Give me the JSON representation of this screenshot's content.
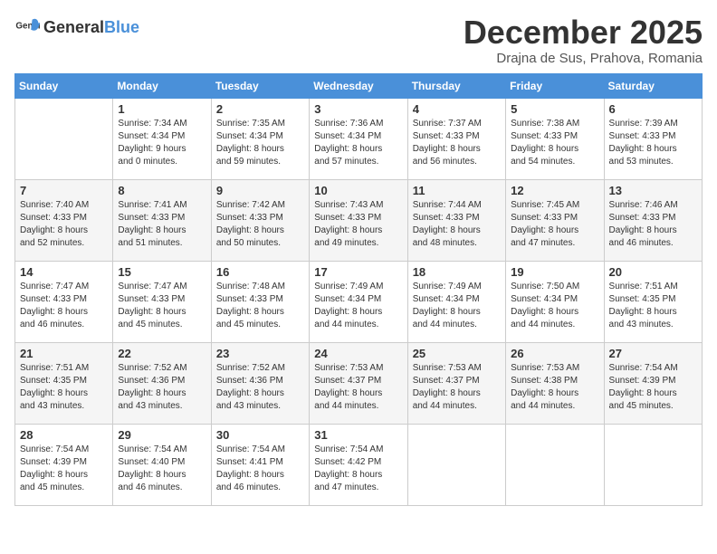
{
  "logo": {
    "general": "General",
    "blue": "Blue"
  },
  "header": {
    "month": "December 2025",
    "location": "Drajna de Sus, Prahova, Romania"
  },
  "days_of_week": [
    "Sunday",
    "Monday",
    "Tuesday",
    "Wednesday",
    "Thursday",
    "Friday",
    "Saturday"
  ],
  "weeks": [
    [
      {
        "day": "",
        "info": ""
      },
      {
        "day": "1",
        "info": "Sunrise: 7:34 AM\nSunset: 4:34 PM\nDaylight: 9 hours\nand 0 minutes."
      },
      {
        "day": "2",
        "info": "Sunrise: 7:35 AM\nSunset: 4:34 PM\nDaylight: 8 hours\nand 59 minutes."
      },
      {
        "day": "3",
        "info": "Sunrise: 7:36 AM\nSunset: 4:34 PM\nDaylight: 8 hours\nand 57 minutes."
      },
      {
        "day": "4",
        "info": "Sunrise: 7:37 AM\nSunset: 4:33 PM\nDaylight: 8 hours\nand 56 minutes."
      },
      {
        "day": "5",
        "info": "Sunrise: 7:38 AM\nSunset: 4:33 PM\nDaylight: 8 hours\nand 54 minutes."
      },
      {
        "day": "6",
        "info": "Sunrise: 7:39 AM\nSunset: 4:33 PM\nDaylight: 8 hours\nand 53 minutes."
      }
    ],
    [
      {
        "day": "7",
        "info": "Sunrise: 7:40 AM\nSunset: 4:33 PM\nDaylight: 8 hours\nand 52 minutes."
      },
      {
        "day": "8",
        "info": "Sunrise: 7:41 AM\nSunset: 4:33 PM\nDaylight: 8 hours\nand 51 minutes."
      },
      {
        "day": "9",
        "info": "Sunrise: 7:42 AM\nSunset: 4:33 PM\nDaylight: 8 hours\nand 50 minutes."
      },
      {
        "day": "10",
        "info": "Sunrise: 7:43 AM\nSunset: 4:33 PM\nDaylight: 8 hours\nand 49 minutes."
      },
      {
        "day": "11",
        "info": "Sunrise: 7:44 AM\nSunset: 4:33 PM\nDaylight: 8 hours\nand 48 minutes."
      },
      {
        "day": "12",
        "info": "Sunrise: 7:45 AM\nSunset: 4:33 PM\nDaylight: 8 hours\nand 47 minutes."
      },
      {
        "day": "13",
        "info": "Sunrise: 7:46 AM\nSunset: 4:33 PM\nDaylight: 8 hours\nand 46 minutes."
      }
    ],
    [
      {
        "day": "14",
        "info": "Sunrise: 7:47 AM\nSunset: 4:33 PM\nDaylight: 8 hours\nand 46 minutes."
      },
      {
        "day": "15",
        "info": "Sunrise: 7:47 AM\nSunset: 4:33 PM\nDaylight: 8 hours\nand 45 minutes."
      },
      {
        "day": "16",
        "info": "Sunrise: 7:48 AM\nSunset: 4:33 PM\nDaylight: 8 hours\nand 45 minutes."
      },
      {
        "day": "17",
        "info": "Sunrise: 7:49 AM\nSunset: 4:34 PM\nDaylight: 8 hours\nand 44 minutes."
      },
      {
        "day": "18",
        "info": "Sunrise: 7:49 AM\nSunset: 4:34 PM\nDaylight: 8 hours\nand 44 minutes."
      },
      {
        "day": "19",
        "info": "Sunrise: 7:50 AM\nSunset: 4:34 PM\nDaylight: 8 hours\nand 44 minutes."
      },
      {
        "day": "20",
        "info": "Sunrise: 7:51 AM\nSunset: 4:35 PM\nDaylight: 8 hours\nand 43 minutes."
      }
    ],
    [
      {
        "day": "21",
        "info": "Sunrise: 7:51 AM\nSunset: 4:35 PM\nDaylight: 8 hours\nand 43 minutes."
      },
      {
        "day": "22",
        "info": "Sunrise: 7:52 AM\nSunset: 4:36 PM\nDaylight: 8 hours\nand 43 minutes."
      },
      {
        "day": "23",
        "info": "Sunrise: 7:52 AM\nSunset: 4:36 PM\nDaylight: 8 hours\nand 43 minutes."
      },
      {
        "day": "24",
        "info": "Sunrise: 7:53 AM\nSunset: 4:37 PM\nDaylight: 8 hours\nand 44 minutes."
      },
      {
        "day": "25",
        "info": "Sunrise: 7:53 AM\nSunset: 4:37 PM\nDaylight: 8 hours\nand 44 minutes."
      },
      {
        "day": "26",
        "info": "Sunrise: 7:53 AM\nSunset: 4:38 PM\nDaylight: 8 hours\nand 44 minutes."
      },
      {
        "day": "27",
        "info": "Sunrise: 7:54 AM\nSunset: 4:39 PM\nDaylight: 8 hours\nand 45 minutes."
      }
    ],
    [
      {
        "day": "28",
        "info": "Sunrise: 7:54 AM\nSunset: 4:39 PM\nDaylight: 8 hours\nand 45 minutes."
      },
      {
        "day": "29",
        "info": "Sunrise: 7:54 AM\nSunset: 4:40 PM\nDaylight: 8 hours\nand 46 minutes."
      },
      {
        "day": "30",
        "info": "Sunrise: 7:54 AM\nSunset: 4:41 PM\nDaylight: 8 hours\nand 46 minutes."
      },
      {
        "day": "31",
        "info": "Sunrise: 7:54 AM\nSunset: 4:42 PM\nDaylight: 8 hours\nand 47 minutes."
      },
      {
        "day": "",
        "info": ""
      },
      {
        "day": "",
        "info": ""
      },
      {
        "day": "",
        "info": ""
      }
    ]
  ]
}
